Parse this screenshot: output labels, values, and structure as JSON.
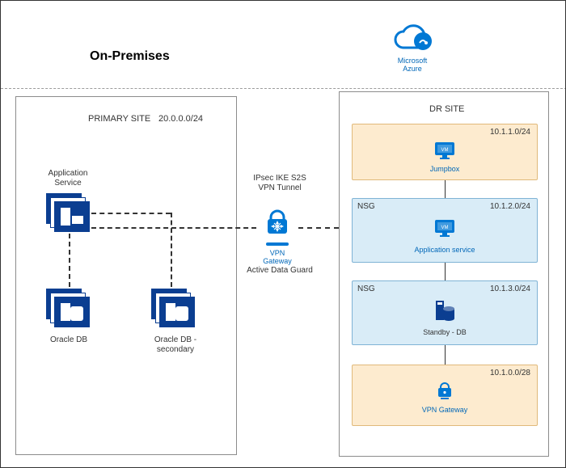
{
  "onprem": {
    "heading": "On-Premises",
    "primary_site_label": "PRIMARY SITE",
    "primary_site_cidr": "20.0.0.0/24",
    "app_service_label": "Application Service",
    "oracle_db_label": "Oracle DB",
    "oracle_db_secondary_label": "Oracle DB - secondary"
  },
  "cloud": {
    "provider_label": "Microsoft Azure",
    "dr_site_label": "DR SITE"
  },
  "center": {
    "ipsec_label": "IPsec IKE S2S VPN Tunnel",
    "vpn_gateway_label": "VPN Gateway",
    "active_data_guard_label": "Active Data Guard"
  },
  "subnets": {
    "jumpbox": {
      "nsg": "",
      "cidr": "10.1.1.0/24",
      "label": "Jumpbox"
    },
    "app": {
      "nsg": "NSG",
      "cidr": "10.1.2.0/24",
      "label": "Application service"
    },
    "standby_db": {
      "nsg": "NSG",
      "cidr": "10.1.3.0/24",
      "label": "Standby - DB"
    },
    "vpn_gateway": {
      "nsg": "",
      "cidr": "10.1.0.0/28",
      "label": "VPN Gateway"
    }
  }
}
